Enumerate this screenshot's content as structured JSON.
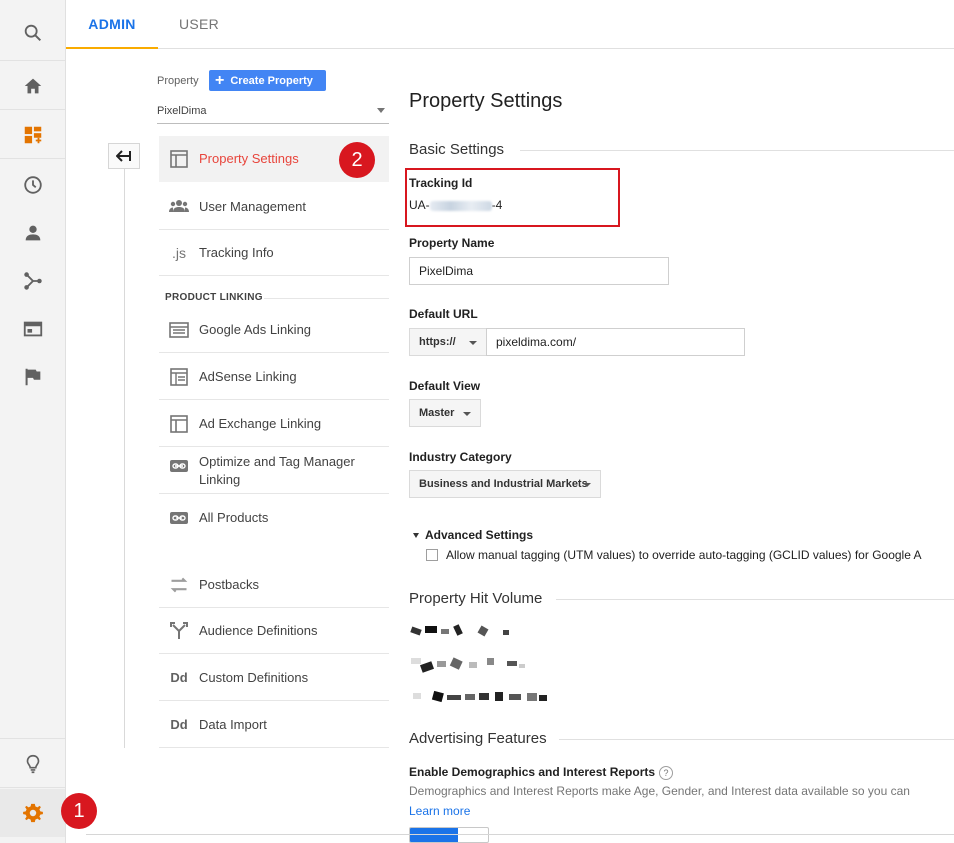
{
  "tabs": [
    {
      "label": "ADMIN"
    },
    {
      "label": "USER"
    }
  ],
  "rail": {
    "icons": [
      "search-icon",
      "home-icon",
      "customization-icon",
      "realtime-clock-icon",
      "audience-person-icon",
      "acquisition-icon",
      "behavior-icon",
      "conversions-flag-icon"
    ],
    "bottom_icons": [
      "lightbulb-icon",
      "admin-gear-icon"
    ],
    "accent_color": "#e37400"
  },
  "property": {
    "label": "Property",
    "create_button": "Create Property",
    "selected": "PixelDima"
  },
  "nav": {
    "items": [
      {
        "label": "Property Settings",
        "icon": "layout-icon"
      },
      {
        "label": "User Management",
        "icon": "people-icon"
      },
      {
        "label": "Tracking Info",
        "icon": "js-icon"
      }
    ],
    "section_heading": "PRODUCT LINKING",
    "linking": [
      {
        "label": "Google Ads Linking",
        "icon": "ads-icon"
      },
      {
        "label": "AdSense Linking",
        "icon": "adsense-icon"
      },
      {
        "label": "Ad Exchange Linking",
        "icon": "layout-icon"
      },
      {
        "label": "Optimize and Tag Manager Linking",
        "icon": "link-icon"
      },
      {
        "label": "All Products",
        "icon": "link-icon"
      }
    ],
    "other": [
      {
        "label": "Postbacks",
        "icon": "postbacks-icon"
      },
      {
        "label": "Audience Definitions",
        "icon": "fork-icon"
      },
      {
        "label": "Custom Definitions",
        "icon": "dd-icon"
      },
      {
        "label": "Data Import",
        "icon": "dd-icon"
      }
    ]
  },
  "badges": {
    "one": "1",
    "two": "2"
  },
  "main": {
    "title": "Property Settings",
    "basic_settings": "Basic Settings",
    "tracking_label": "Tracking Id",
    "tracking_prefix": "UA-",
    "tracking_suffix": "-4",
    "property_name_label": "Property Name",
    "property_name_value": "PixelDima",
    "default_url_label": "Default URL",
    "url_scheme": "https://",
    "url_value": "pixeldima.com/",
    "default_view_label": "Default View",
    "default_view_value": "Master",
    "industry_label": "Industry Category",
    "industry_value": "Business and Industrial Markets",
    "advanced_label": "Advanced Settings",
    "manual_tagging_text": "Allow manual tagging (UTM values) to override auto-tagging (GCLID values) for Google A",
    "hit_volume_title": "Property Hit Volume",
    "advertising_title": "Advertising Features",
    "demographics_title": "Enable Demographics and Interest Reports",
    "help_glyph": "?",
    "demographics_desc": "Demographics and Interest Reports make Age, Gender, and Interest data available so you can",
    "learn_more": "Learn more"
  }
}
